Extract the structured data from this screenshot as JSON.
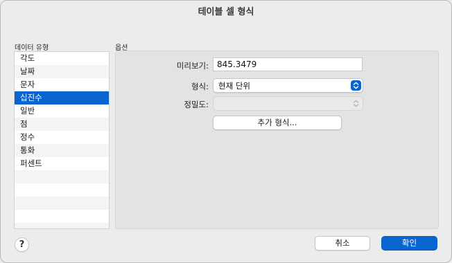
{
  "window": {
    "title": "테이블 셀 형식"
  },
  "data_types": {
    "header": "데이터 유형",
    "items": [
      "각도",
      "날짜",
      "문자",
      "십진수",
      "일반",
      "점",
      "정수",
      "통화",
      "퍼센트"
    ],
    "selected": "십진수"
  },
  "options": {
    "header": "옵션",
    "preview_label": "미리보기:",
    "preview_value": "845.3479",
    "format_label": "형식:",
    "format_value": "현재 단위",
    "precision_label": "정밀도:",
    "precision_value": "",
    "more_formats_label": "추가 형식..."
  },
  "footer": {
    "help_label": "?",
    "cancel_label": "취소",
    "ok_label": "확인"
  },
  "colors": {
    "accent": "#0a64d0",
    "window_bg": "#ececec",
    "panel_bg": "#e3e3e3"
  },
  "icons": [
    "popup-chevron-icon",
    "stepper-chevron-icon",
    "help-icon"
  ]
}
